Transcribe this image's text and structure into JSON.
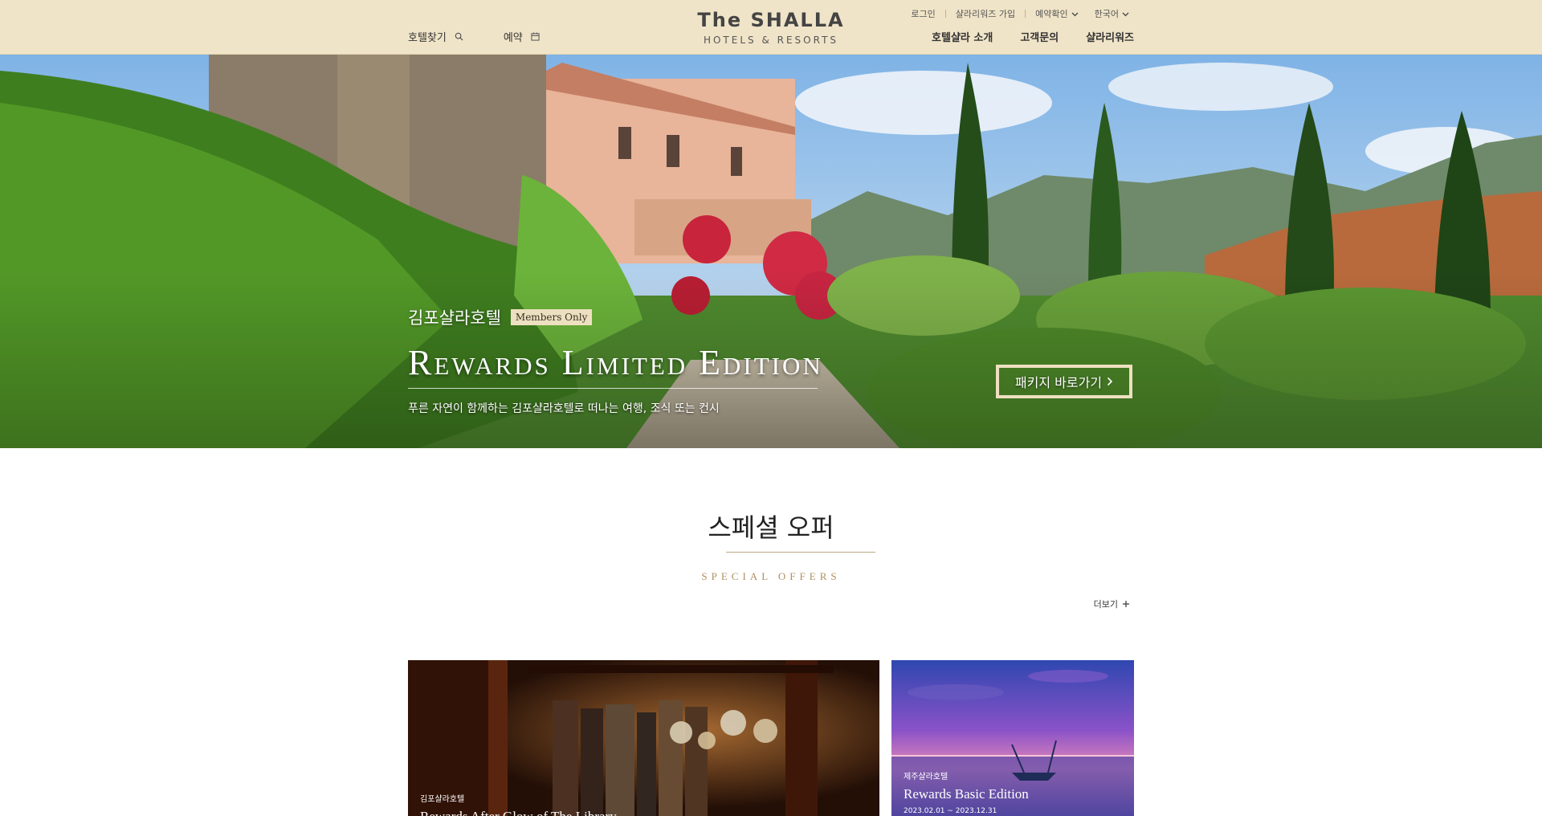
{
  "header": {
    "nav_left": [
      {
        "label": "호텔찾기",
        "icon": "search-icon"
      },
      {
        "label": "예약",
        "icon": "calendar-icon"
      }
    ],
    "logo": {
      "title": "The SHALLA",
      "subtitle": "HOTELS & RESORTS"
    },
    "utility": {
      "login": "로그인",
      "join": "샬라리워즈 가입",
      "reservation": "예약확인",
      "language": "한국어"
    },
    "nav_right": [
      "호텔샬라 소개",
      "고객문의",
      "샬라리워즈"
    ]
  },
  "hero": {
    "hotel": "김포샬라호텔",
    "badge": "Members Only",
    "title": "Rewards Limited Edition",
    "description": "푸른 자연이 함께하는 김포샬라호텔로 떠나는 여행, 조식 또는 컨시",
    "cta": "패키지 바로가기",
    "cta_icon": "chevron-right-icon"
  },
  "offers": {
    "title": "스페셜 오퍼",
    "subtitle": "SPECIAL OFFERS",
    "more": "더보기",
    "more_icon": "plus-icon",
    "cards": [
      {
        "hotel": "김포샬라호텔",
        "title": "Rewards After Glow of The Library",
        "date": ""
      },
      {
        "hotel": "제주샬라호텔",
        "title": "Rewards Basic Edition",
        "date": "2023.02.01 ~ 2023.12.31"
      }
    ]
  },
  "colors": {
    "header_bg": "#f0e4c8",
    "accent_gold": "#b09060",
    "badge_bg": "#ede0c0"
  }
}
